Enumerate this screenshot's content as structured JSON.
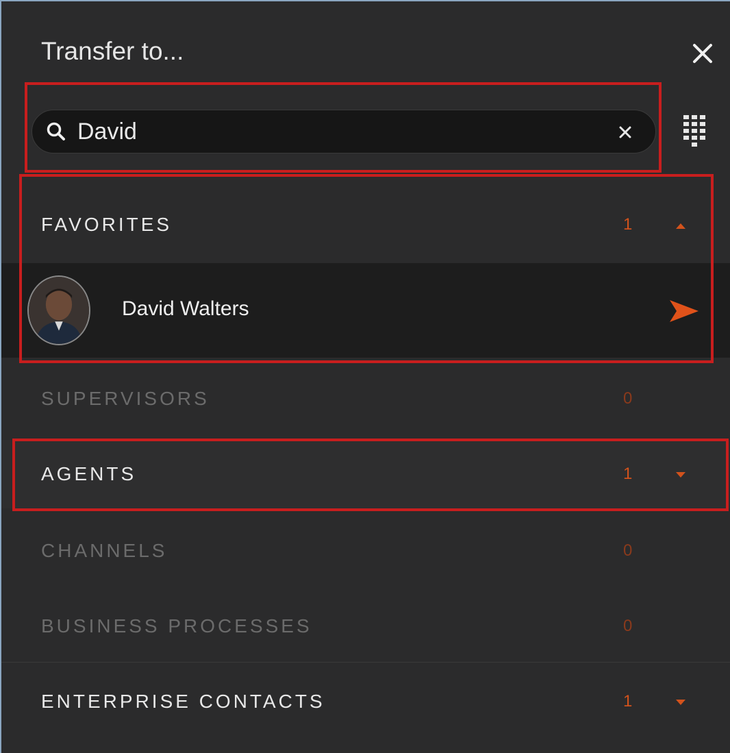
{
  "header": {
    "title": "Transfer to..."
  },
  "search": {
    "value": "David"
  },
  "sections": [
    {
      "label": "FAVORITES",
      "count": "1",
      "expanded": true
    },
    {
      "label": "SUPERVISORS",
      "count": "0"
    },
    {
      "label": "AGENTS",
      "count": "1",
      "expanded": false
    },
    {
      "label": "CHANNELS",
      "count": "0"
    },
    {
      "label": "BUSINESS PROCESSES",
      "count": "0"
    },
    {
      "label": "ENTERPRISE CONTACTS",
      "count": "1",
      "expanded": false
    }
  ],
  "favorites": [
    {
      "name": "David Walters"
    }
  ],
  "colors": {
    "accent": "#d2521c",
    "highlight": "#c81e1e",
    "background": "#2b2b2c"
  }
}
